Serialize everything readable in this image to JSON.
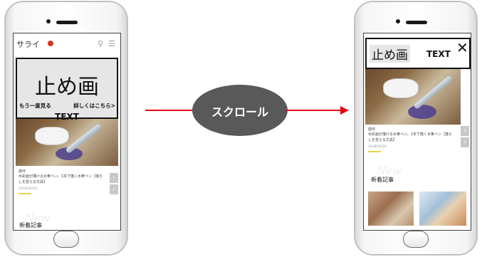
{
  "left_screen": {
    "logo": "サライ",
    "search_icon": "search-icon",
    "menu_icon": "menu-icon",
    "ad_main": "止め画",
    "ad_replay": "もう一度見る",
    "ad_details": "詳しくはこちら>",
    "ad_text": "TEXT",
    "article_category": "趣味",
    "article_title": "水彩画が描ける水筆ペン。1本で描く水筆ペン［描らしを変える文具】",
    "article_date": "2018/02/20",
    "new_label_bg": "New",
    "new_label": "新着記事"
  },
  "arrow": {
    "label": "スクロール",
    "color": "#e60012"
  },
  "right_screen": {
    "ad_main": "止め画",
    "ad_text": "TEXT",
    "close_glyph": "✕",
    "article_category": "趣味",
    "article_title": "水彩画が描ける水筆ペン。1本で描く水筆ペン［描らしを変える文具】",
    "article_date": "2018/02/20",
    "new_label_bg": "New",
    "new_label": "新着記事"
  }
}
